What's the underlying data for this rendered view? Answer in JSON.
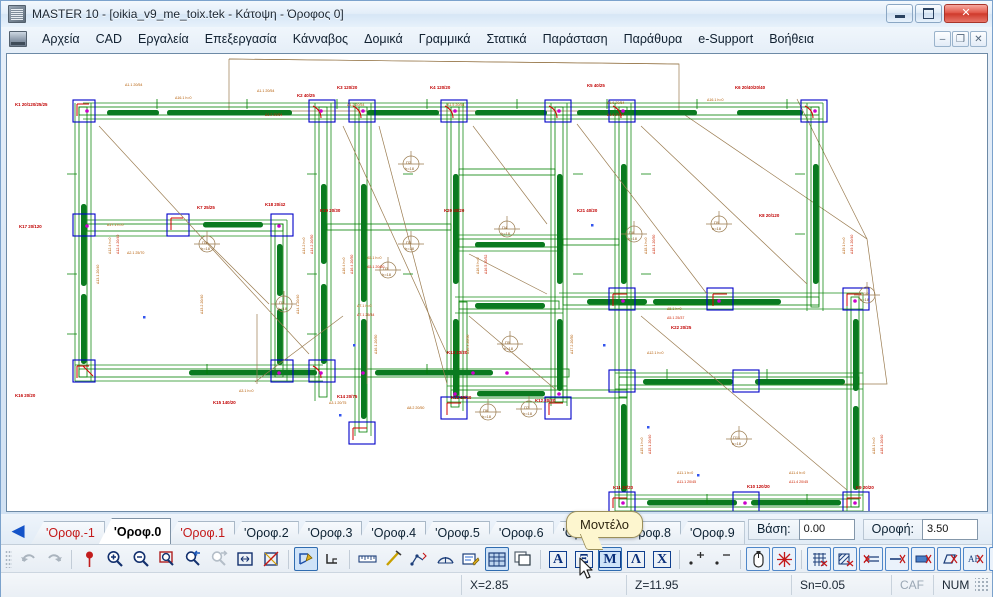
{
  "window": {
    "title": "MASTER 10 - [oikia_v9_me_toix.tek - Κάτοψη - Όροφος 0]",
    "app_icon": "master-app-icon",
    "minimize": "–",
    "maximize": "□",
    "close": "✕"
  },
  "menubar": {
    "mdi_icon": "document-icon",
    "items": [
      {
        "label": "Αρχεία"
      },
      {
        "label": "CAD"
      },
      {
        "label": "Εργαλεία"
      },
      {
        "label": "Επεξεργασία"
      },
      {
        "label": "Κάνναβος"
      },
      {
        "label": "Δομικά"
      },
      {
        "label": "Γραμμικά"
      },
      {
        "label": "Στατικά"
      },
      {
        "label": "Παράσταση"
      },
      {
        "label": "Παράθυρα"
      },
      {
        "label": "e-Support"
      },
      {
        "label": "Βοήθεια"
      }
    ],
    "mdi_controls": [
      {
        "name": "mdi-minimize",
        "glyph": "–"
      },
      {
        "name": "mdi-restore",
        "glyph": "❐"
      },
      {
        "name": "mdi-close",
        "glyph": "✕"
      }
    ]
  },
  "tabs": {
    "scroll_left": "◀",
    "scroll_right": "➡",
    "items": [
      {
        "label": "'Οροφ.-1",
        "color": "red",
        "active": false
      },
      {
        "label": "'Οροφ.0",
        "color": "black",
        "active": true
      },
      {
        "label": "'Οροφ.1",
        "color": "red",
        "active": false
      },
      {
        "label": "'Οροφ.2",
        "color": "black",
        "active": false
      },
      {
        "label": "'Οροφ.3",
        "color": "black",
        "active": false
      },
      {
        "label": "'Οροφ.4",
        "color": "black",
        "active": false
      },
      {
        "label": "'Οροφ.5",
        "color": "black",
        "active": false
      },
      {
        "label": "'Οροφ.6",
        "color": "black",
        "active": false
      },
      {
        "label": "'Οροφ.7",
        "color": "black",
        "active": false
      },
      {
        "label": "'Οροφ.8",
        "color": "black",
        "active": false
      },
      {
        "label": "'Οροφ.9",
        "color": "black",
        "active": false
      }
    ],
    "base_label": "Βάση:",
    "base_value": "0.00",
    "roof_label": "Οροφή:",
    "roof_value": "3.50"
  },
  "tooltip": {
    "text": "Μοντέλο"
  },
  "toolbar": {
    "groups": [
      {
        "buttons": [
          {
            "name": "undo-icon",
            "label": "Αναίρεση",
            "state": "disabled"
          },
          {
            "name": "redo-icon",
            "label": "Επανάληψη",
            "state": "disabled"
          }
        ]
      },
      {
        "buttons": [
          {
            "name": "marker-pin-icon",
            "label": "Σημείο",
            "state": "normal"
          },
          {
            "name": "zoom-in-icon",
            "label": "Μεγέθυνση",
            "state": "normal"
          },
          {
            "name": "zoom-out-icon",
            "label": "Σμίκρυνση",
            "state": "normal"
          },
          {
            "name": "zoom-window-icon",
            "label": "Παράθυρο ζουμ",
            "state": "normal"
          },
          {
            "name": "zoom-previous-icon",
            "label": "Προηγούμενο ζουμ",
            "state": "normal"
          },
          {
            "name": "zoom-next-icon",
            "label": "Επόμενο ζουμ",
            "state": "disabled"
          },
          {
            "name": "zoom-extents-icon",
            "label": "Όλο το σχέδιο",
            "state": "normal"
          },
          {
            "name": "zoom-redraw-icon",
            "label": "Ανασχεδίαση",
            "state": "normal"
          }
        ]
      },
      {
        "buttons": [
          {
            "name": "pan-icon",
            "label": "Μετακίνηση",
            "state": "selected"
          },
          {
            "name": "ortho-icon",
            "label": "Ορθοκανονικά",
            "state": "normal"
          }
        ]
      },
      {
        "buttons": [
          {
            "name": "ruler-icon",
            "label": "Μέτρηση",
            "state": "normal"
          },
          {
            "name": "line-icon",
            "label": "Γραμμή",
            "state": "normal"
          },
          {
            "name": "polyline-icon",
            "label": "Πολυγραμμή",
            "state": "normal"
          },
          {
            "name": "arc-icon",
            "label": "Τόξο",
            "state": "normal"
          },
          {
            "name": "note-icon",
            "label": "Σημείωση",
            "state": "normal"
          },
          {
            "name": "grid-table-icon",
            "label": "Κάνναβος",
            "state": "selected"
          },
          {
            "name": "copy-layers-icon",
            "label": "Στρώσεις",
            "state": "normal"
          }
        ]
      },
      {
        "buttons": [
          {
            "name": "letter-a-icon",
            "label": "Α",
            "state": "normal"
          },
          {
            "name": "letter-xi-icon",
            "label": "Ξ",
            "state": "normal"
          },
          {
            "name": "letter-mu-icon",
            "label": "Μ",
            "state": "selected"
          },
          {
            "name": "letter-lambda-icon",
            "label": "Λ",
            "state": "normal"
          },
          {
            "name": "letter-chi-icon",
            "label": "Χ",
            "state": "normal"
          }
        ]
      },
      {
        "buttons": [
          {
            "name": "point-plus-icon",
            "label": "Προσθήκη σημείου",
            "state": "normal"
          },
          {
            "name": "point-minus-icon",
            "label": "Αφαίρεση σημείου",
            "state": "normal"
          }
        ]
      },
      {
        "buttons": [
          {
            "name": "mouse-icon",
            "label": "Ποντίκι",
            "state": "framed"
          },
          {
            "name": "snap-star-icon",
            "label": "Έλξη",
            "state": "framed"
          }
        ]
      },
      {
        "buttons": [
          {
            "name": "grid-off-icon",
            "label": "Κάνναβος off",
            "state": "framed"
          },
          {
            "name": "hatch-off-icon",
            "label": "Διαγράμμιση off",
            "state": "framed"
          },
          {
            "name": "beam-off-icon",
            "label": "Δοκοί off",
            "state": "framed"
          },
          {
            "name": "line-off-icon",
            "label": "Γραμμές off",
            "state": "framed"
          },
          {
            "name": "slab-off-icon",
            "label": "Πλάκες off",
            "state": "framed"
          },
          {
            "name": "shape-off-icon",
            "label": "Σχήματα off",
            "state": "framed"
          },
          {
            "name": "text-off-icon",
            "label": "Κείμενο off",
            "state": "framed"
          },
          {
            "name": "dim-off-icon",
            "label": "Διαστάσεις off",
            "state": "framed"
          },
          {
            "name": "wall-off-icon",
            "label": "Τοίχοι off",
            "state": "framed"
          },
          {
            "name": "node-off-icon",
            "label": "Κόμβοι off",
            "state": "framed"
          }
        ]
      }
    ]
  },
  "statusbar": {
    "x": "X=2.85",
    "z": "Z=11.95",
    "sn": "Sn=0.05",
    "caf": "CAF",
    "num": "NUM"
  },
  "drawing": {
    "columns": [
      {
        "id": "K1",
        "size": "20/120/20/20"
      },
      {
        "id": "K2",
        "size": "40/25"
      },
      {
        "id": "K3",
        "size": "120/20"
      },
      {
        "id": "K4",
        "size": "120/20"
      },
      {
        "id": "K5",
        "size": "40/25"
      },
      {
        "id": "K6",
        "size": "20/40/20/40"
      },
      {
        "id": "K8",
        "size": "20/120"
      },
      {
        "id": "K9",
        "size": "20/20"
      },
      {
        "id": "K10",
        "size": "120/20"
      },
      {
        "id": "K11",
        "size": "20/20"
      },
      {
        "id": "K12",
        "size": "20/20"
      },
      {
        "id": "K13",
        "size": "20/20"
      },
      {
        "id": "K14",
        "size": "20/75"
      },
      {
        "id": "K15",
        "size": "140/20"
      },
      {
        "id": "K16",
        "size": "20/20"
      },
      {
        "id": "K17",
        "size": "20/120"
      },
      {
        "id": "K18",
        "size": "20/42"
      },
      {
        "id": "K19",
        "size": "20/20"
      },
      {
        "id": "K20",
        "size": "40/20"
      },
      {
        "id": "K21",
        "size": "40/20"
      },
      {
        "id": "K22",
        "size": "20/25"
      }
    ],
    "slabs": [
      {
        "id": "Π1",
        "thickness": "h=18"
      },
      {
        "id": "Π2",
        "thickness": "h=18"
      },
      {
        "id": "Π3",
        "thickness": "h=18"
      },
      {
        "id": "Π4",
        "thickness": "h=18"
      },
      {
        "id": "Π5",
        "thickness": "h=18"
      },
      {
        "id": "Π6",
        "thickness": "h=18"
      },
      {
        "id": "Π7",
        "thickness": "h=18"
      },
      {
        "id": "Π8",
        "thickness": "h=18"
      },
      {
        "id": "Π9",
        "thickness": "h=18"
      },
      {
        "id": "Π10",
        "thickness": "h=18"
      }
    ],
    "beams": [
      {
        "id": "Δ1.1",
        "size": "20/54"
      },
      {
        "id": "Δ1.2",
        "size": "20/54"
      },
      {
        "id": "Δ1.5",
        "size": "20/54"
      },
      {
        "id": "Δ1.6",
        "size": "20/54"
      },
      {
        "id": "Δ2.1",
        "size": "25/70"
      },
      {
        "id": "Δ3.1",
        "size": "20/75"
      },
      {
        "id": "Δ5.1",
        "size": "25/37"
      },
      {
        "id": "Δ7.1",
        "size": "25/34"
      },
      {
        "id": "Δ8.2",
        "size": "20/50"
      },
      {
        "id": "Δ11.1",
        "size": "20/45"
      },
      {
        "id": "Δ11.4",
        "size": "20/45"
      },
      {
        "id": "Δ12.4",
        "size": "20/40"
      },
      {
        "id": "Δ14.2",
        "size": "20/50"
      },
      {
        "id": "Δ15.1",
        "size": "20/40"
      },
      {
        "id": "Δ16.4",
        "size": "20/50"
      },
      {
        "id": "Δ16.5",
        "size": "20/52"
      },
      {
        "id": "Δ17.1",
        "size": "20/50"
      },
      {
        "id": "Δ18.1",
        "size": "20/50"
      },
      {
        "id": "Δ19.1",
        "size": "20/40"
      }
    ]
  }
}
